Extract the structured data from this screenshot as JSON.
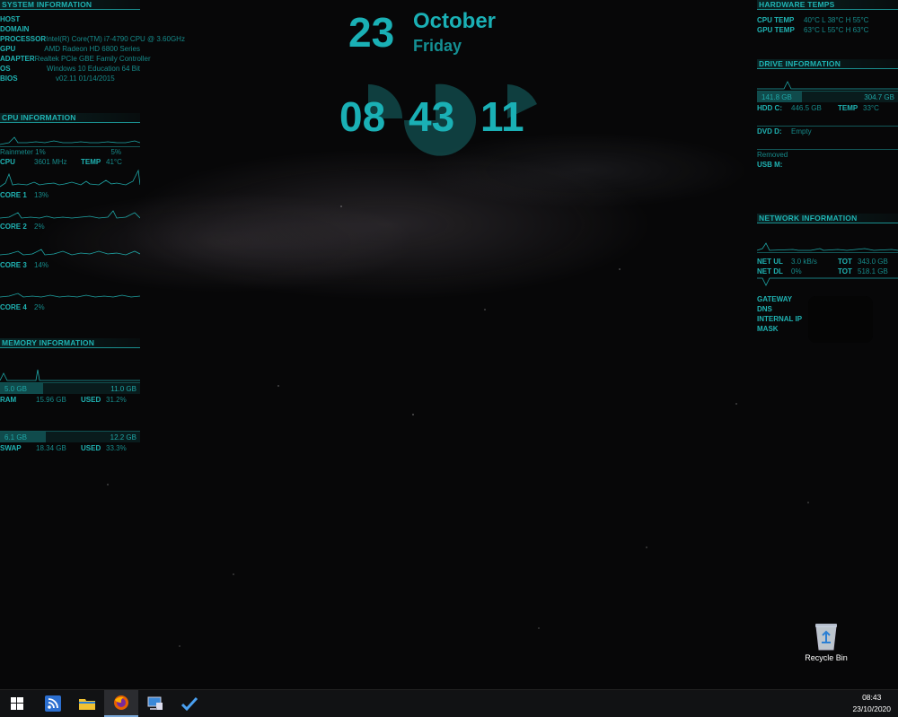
{
  "system": {
    "header": "SYSTEM INFORMATION",
    "rows": [
      {
        "k": "HOST",
        "v": ""
      },
      {
        "k": "DOMAIN",
        "v": ""
      },
      {
        "k": "PROCESSOR",
        "v": "Intel(R) Core(TM) i7-4790 CPU @ 3.60GHz"
      },
      {
        "k": "GPU",
        "v": "AMD Radeon HD 6800 Series"
      },
      {
        "k": "ADAPTER",
        "v": "Realtek PCIe GBE Family Controller"
      },
      {
        "k": "OS",
        "v": "Windows 10 Education 64 Bit"
      },
      {
        "k": "BIOS",
        "v": "v02.11  01/14/2015"
      }
    ]
  },
  "cpu": {
    "header": "CPU INFORMATION",
    "rainmeter_label": "Rainmeter 1%",
    "rainmeter_val": "5%",
    "cpu_k": "CPU",
    "cpu_v": "3601 MHz",
    "temp_k": "TEMP",
    "temp_v": "41°C",
    "cores": [
      {
        "k": "CORE 1",
        "v": "13%"
      },
      {
        "k": "CORE 2",
        "v": "2%"
      },
      {
        "k": "CORE 3",
        "v": "14%"
      },
      {
        "k": "CORE 4",
        "v": "2%"
      }
    ]
  },
  "memory": {
    "header": "MEMORY INFORMATION",
    "ram_used": "5.0 GB",
    "ram_total": "11.0 GB",
    "ram_fill": 0.31,
    "ram_k": "RAM",
    "ram_v": "15.96 GB",
    "ram_used_k": "USED",
    "ram_used_v": "31.2%",
    "swap_used": "6.1 GB",
    "swap_total": "12.2 GB",
    "swap_fill": 0.33,
    "swap_k": "SWAP",
    "swap_v": "18.34 GB",
    "swap_used_k": "USED",
    "swap_used_v": "33.3%"
  },
  "clock": {
    "day": "23",
    "month": "October",
    "weekday": "Friday",
    "hh": "08",
    "mm": "43",
    "ss": "11"
  },
  "hw": {
    "header": "HARDWARE TEMPS",
    "cpu_k": "CPU TEMP",
    "cpu_v": "40°C  L 38°C  H 55°C",
    "gpu_k": "GPU TEMP",
    "gpu_v": "63°C  L 55°C  H 63°C"
  },
  "drive": {
    "header": "DRIVE INFORMATION",
    "c_used": "141.8 GB",
    "c_total": "304.7 GB",
    "c_fill": 0.32,
    "hdd_k": "HDD C:",
    "hdd_v": "446.5 GB",
    "temp_k": "TEMP",
    "temp_v": "33°C",
    "dvd_k": "DVD D:",
    "dvd_v": "Empty",
    "usb_status": "Removed",
    "usb_k": "USB M:"
  },
  "network": {
    "header": "NETWORK INFORMATION",
    "ul_k": "NET UL",
    "ul_v": "3.0 kB/s",
    "ul_tot_k": "TOT",
    "ul_tot_v": "343.0 GB",
    "dl_k": "NET DL",
    "dl_v": "0%",
    "dl_tot_k": "TOT",
    "dl_tot_v": "518.1 GB",
    "gateway_k": "GATEWAY",
    "dns_k": "DNS",
    "ip_k": "INTERNAL IP",
    "mask_k": "MASK"
  },
  "desktop": {
    "recycle_label": "Recycle Bin"
  },
  "taskbar": {
    "time": "08:43",
    "date": "23/10/2020"
  },
  "colors": {
    "accent": "#1fa7a7",
    "taskbar": "#111214"
  }
}
